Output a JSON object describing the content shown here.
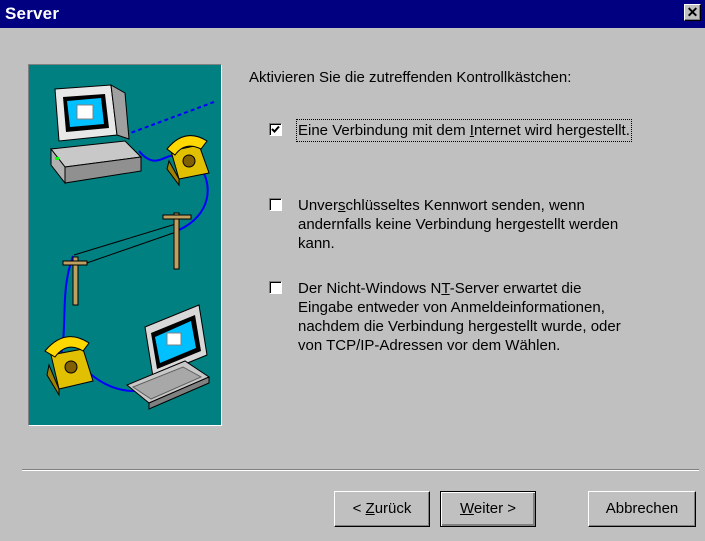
{
  "window": {
    "title": "Server",
    "close_glyph": "✕"
  },
  "instruction": "Aktivieren Sie die zutreffenden Kontrollkästchen:",
  "options": [
    {
      "checked": true,
      "lines": [
        [
          {
            "t": "Eine Verbindung mit dem "
          },
          {
            "t": "I",
            "u": true
          },
          {
            "t": "nternet wird hergestellt."
          }
        ]
      ]
    },
    {
      "checked": false,
      "lines": [
        [
          {
            "t": "Unver"
          },
          {
            "t": "s",
            "u": true
          },
          {
            "t": "chlüsseltes Kennwort senden, wenn"
          }
        ],
        [
          {
            "t": "andernfalls keine Verbindung hergestellt werden"
          }
        ],
        [
          {
            "t": "kann."
          }
        ]
      ]
    },
    {
      "checked": false,
      "lines": [
        [
          {
            "t": "Der Nicht-Windows N"
          },
          {
            "t": "T",
            "u": true
          },
          {
            "t": "-Server erwartet die"
          }
        ],
        [
          {
            "t": "Eingabe entweder von Anmeldeinformationen,"
          }
        ],
        [
          {
            "t": "nachdem die Verbindung hergestellt wurde, oder"
          }
        ],
        [
          {
            "t": "von TCP/IP-Adressen vor dem Wählen."
          }
        ]
      ]
    }
  ],
  "buttons": {
    "back": [
      {
        "t": "< "
      },
      {
        "t": "Z",
        "u": true
      },
      {
        "t": "urück"
      }
    ],
    "next": [
      {
        "t": "W",
        "u": true
      },
      {
        "t": "eiter >"
      }
    ],
    "cancel": [
      {
        "t": "Abbrechen"
      }
    ]
  },
  "illustration": {
    "background": "#008080",
    "icons": [
      "desktop-computer-icon",
      "telephone-icon",
      "telephone-pole-icon",
      "laptop-icon"
    ]
  },
  "colors": {
    "titlebar": "#000080",
    "dialog": "#c0c0c0",
    "cable": "#0000ff"
  }
}
